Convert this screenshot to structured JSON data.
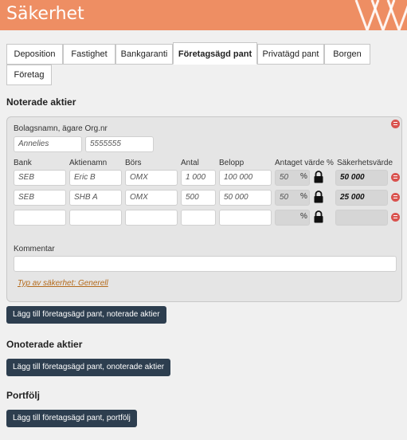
{
  "header": {
    "title": "Säkerhet"
  },
  "tabs": [
    {
      "label": "Deposition"
    },
    {
      "label": "Fastighet"
    },
    {
      "label": "Bankgaranti"
    },
    {
      "label": "Företagsägd pant"
    },
    {
      "label": "Privatägd pant"
    },
    {
      "label": "Borgen"
    },
    {
      "label": "Företag"
    }
  ],
  "active_tab": "Företagsägd pant",
  "sections": {
    "noterade": "Noterade aktier",
    "onoterade": "Onoterade aktier",
    "portfolj": "Portfölj"
  },
  "noterade_panel": {
    "owner_label": "Bolagsnamn, ägare Org.nr",
    "owner_name": "Annelies",
    "owner_orgnr": "5555555",
    "columns": [
      "Bank",
      "Aktienamn",
      "Börs",
      "Antal",
      "Belopp",
      "Antaget värde %",
      "Säkerhetsvärde"
    ],
    "rows": [
      {
        "bank": "SEB",
        "aktienamn": "Eric B",
        "bors": "OMX",
        "antal": "1 000",
        "belopp": "100 000",
        "antaget": "50",
        "sakerhetsvarde": "50 000"
      },
      {
        "bank": "SEB",
        "aktienamn": "SHB A",
        "bors": "OMX",
        "antal": "500",
        "belopp": "50 000",
        "antaget": "50",
        "sakerhetsvarde": "25 000"
      },
      {
        "bank": "",
        "aktienamn": "",
        "bors": "",
        "antal": "",
        "belopp": "",
        "antaget": "",
        "sakerhetsvarde": ""
      }
    ],
    "percent_sign": "%",
    "comment_label": "Kommentar",
    "comment_value": "",
    "type_link": "Typ av säkerhet: Generell"
  },
  "buttons": {
    "add_noterade": "Lägg till företagsägd pant, noterade aktier",
    "add_onoterade": "Lägg till företagsägd pant, onoterade aktier",
    "add_portfolj": "Lägg till företagsägd pant, portfölj"
  },
  "colors": {
    "header": "#ee8e63",
    "button": "#2d3e4f",
    "delete": "#d9534f",
    "link": "#b46a1b"
  }
}
